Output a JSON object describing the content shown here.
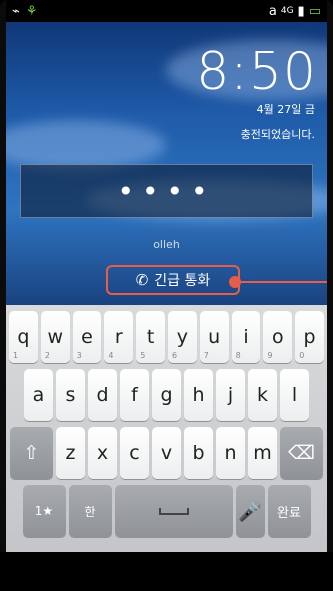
{
  "status": {
    "left_icons": [
      "usb-icon",
      "android-icon"
    ],
    "right_text": "a",
    "network": "4G"
  },
  "clock": {
    "time": "8:50",
    "date": "4월 27일 금",
    "charging": "충전되었습니다."
  },
  "lockscreen": {
    "pin_mask": "••••",
    "carrier": "olleh",
    "emergency_label": "긴급 통화"
  },
  "keyboard": {
    "row1": [
      "q",
      "w",
      "e",
      "r",
      "t",
      "y",
      "u",
      "i",
      "o",
      "p"
    ],
    "row1_sub": [
      "1",
      "2",
      "3",
      "4",
      "5",
      "6",
      "7",
      "8",
      "9",
      "0"
    ],
    "row2": [
      "a",
      "s",
      "d",
      "f",
      "g",
      "h",
      "j",
      "k",
      "l"
    ],
    "row3": [
      "z",
      "x",
      "c",
      "v",
      "b",
      "n",
      "m"
    ],
    "sym_key": "1★",
    "lang_key": "한",
    "done_key": "완료"
  }
}
